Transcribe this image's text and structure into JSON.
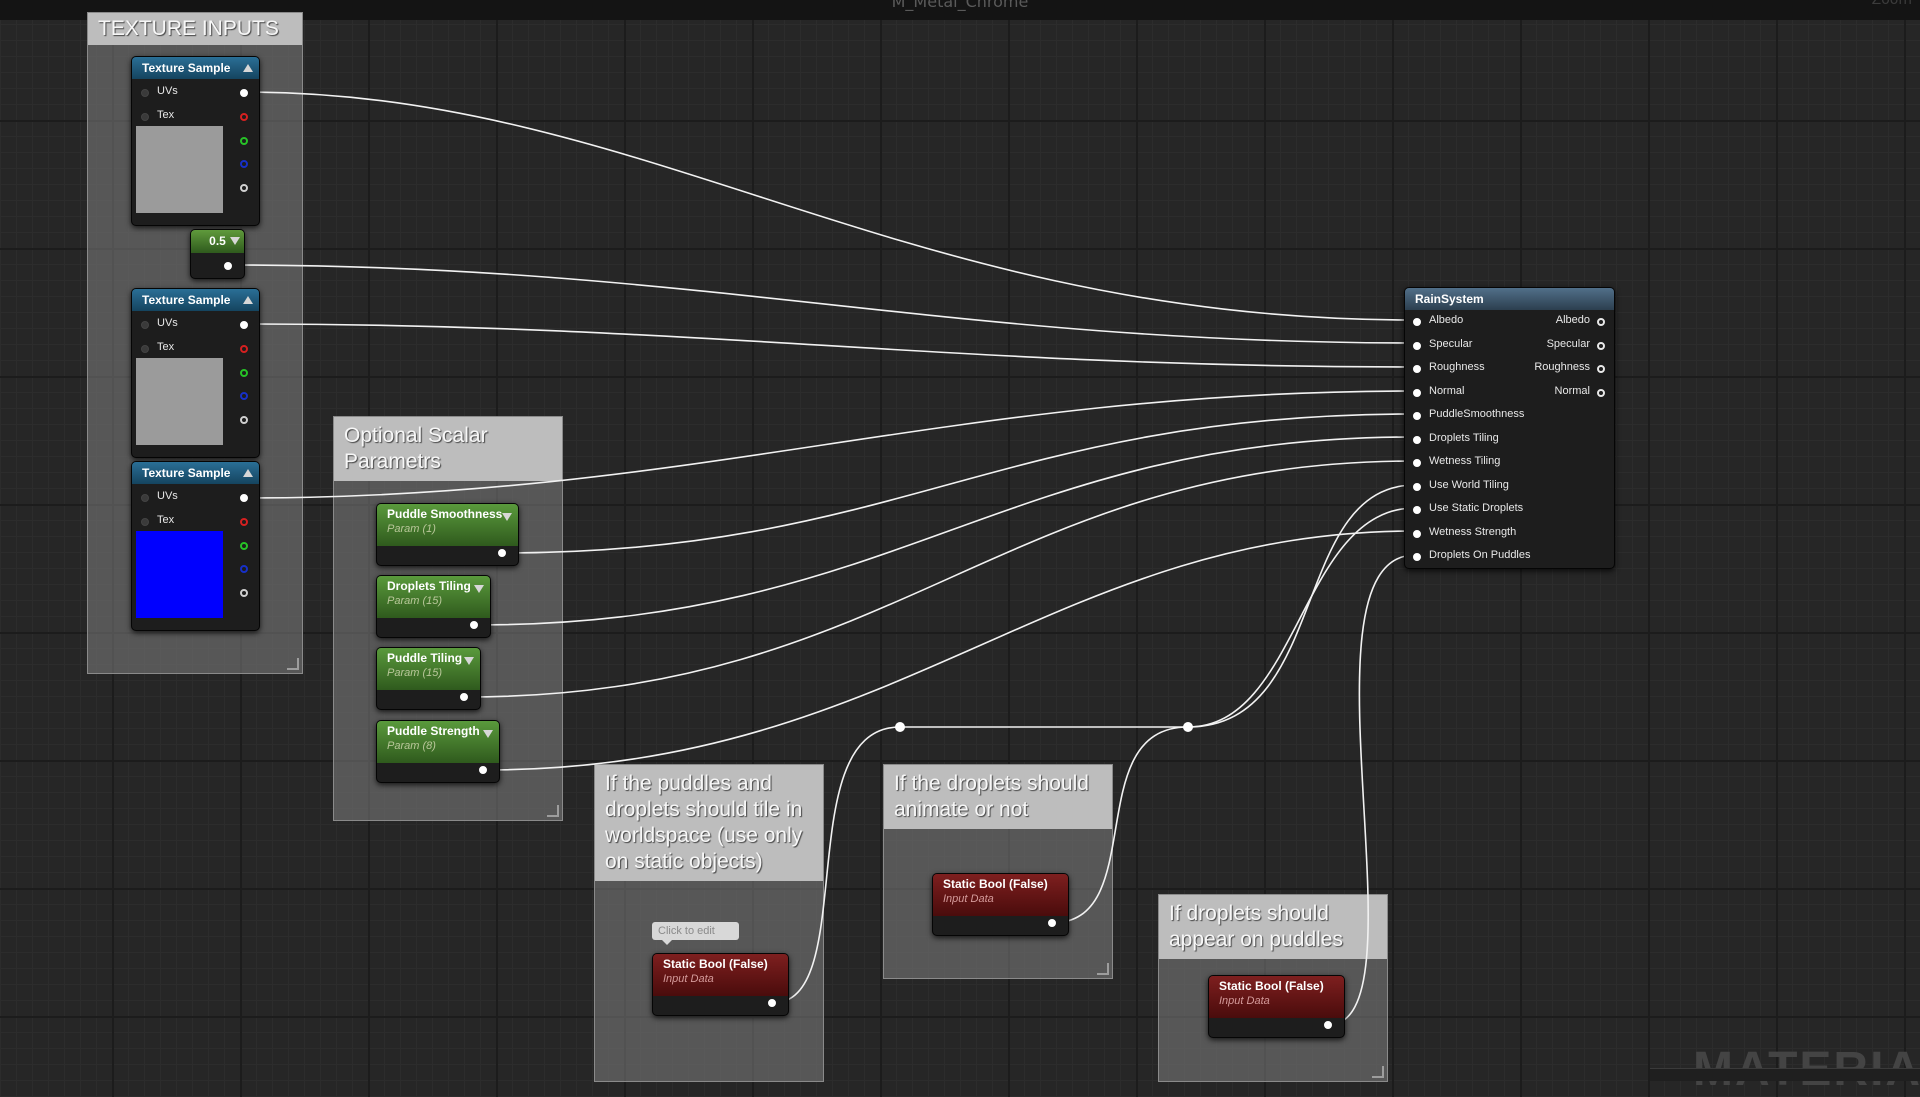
{
  "window": {
    "title": "M_Metal_Chrome",
    "corner_label": "Zoom"
  },
  "watermark": "MATERIAL",
  "comments": {
    "texture_inputs": "TEXTURE INPUTS",
    "optional_scalar": "Optional Scalar Parametrs",
    "world_tiling": "If the puddles and droplets should tile in worldspace (use only on static objects)",
    "animate": "If the droplets should animate or not",
    "puddles": "If droplets should appear on puddles"
  },
  "texture_samples": [
    {
      "title": "Texture Sample",
      "uv_label": "UVs",
      "tex_label": "Tex",
      "preview_color": "#9b9b9b"
    },
    {
      "title": "Texture Sample",
      "uv_label": "UVs",
      "tex_label": "Tex",
      "preview_color": "#9b9b9b"
    },
    {
      "title": "Texture Sample",
      "uv_label": "UVs",
      "tex_label": "Tex",
      "preview_color": "#0000ff"
    }
  ],
  "constant": {
    "value": "0.5"
  },
  "params": [
    {
      "title": "Puddle Smoothness",
      "sub": "Param (1)"
    },
    {
      "title": "Droplets Tiling",
      "sub": "Param (15)"
    },
    {
      "title": "Puddle Tiling",
      "sub": "Param (15)"
    },
    {
      "title": "Puddle Strength",
      "sub": "Param (8)"
    }
  ],
  "static_bools": [
    {
      "title": "Static Bool (False)",
      "sub": "Input Data"
    },
    {
      "title": "Static Bool (False)",
      "sub": "Input Data"
    },
    {
      "title": "Static Bool (False)",
      "sub": "Input Data"
    }
  ],
  "click_to_edit": "Click to edit",
  "rain_system": {
    "title": "RainSystem",
    "inputs": [
      "Albedo",
      "Specular",
      "Roughness",
      "Normal",
      "PuddleSmoothness",
      "Droplets Tiling",
      "Wetness Tiling",
      "Use World Tiling",
      "Use Static Droplets",
      "Wetness Strength",
      "Droplets On Puddles"
    ],
    "outputs": [
      "Albedo",
      "Specular",
      "Roughness",
      "Normal"
    ]
  }
}
